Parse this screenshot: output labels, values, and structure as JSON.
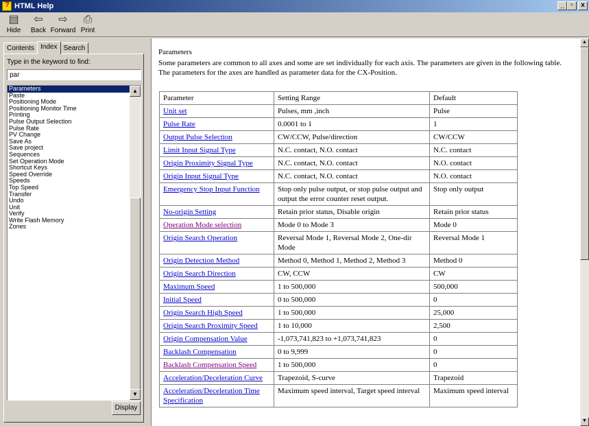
{
  "window": {
    "title": "HTML Help",
    "controls": [
      "_",
      "▫",
      "x"
    ]
  },
  "toolbar": [
    {
      "label": "Hide",
      "icon": "hide-pane-icon",
      "glyph": "▤"
    },
    {
      "label": "Back",
      "icon": "back-arrow-icon",
      "glyph": "⇦"
    },
    {
      "label": "Forward",
      "icon": "forward-arrow-icon",
      "glyph": "⇨"
    },
    {
      "label": "Print",
      "icon": "printer-icon",
      "glyph": "⎙"
    }
  ],
  "nav": {
    "tabs": [
      "Contents",
      "Index",
      "Search"
    ],
    "active_tab": "Index",
    "prompt": "Type in the keyword to find:",
    "keyword": "par",
    "items": [
      "Parameters",
      "Paste",
      "Positioning Mode",
      "Positioning Monitor Time",
      "Printing",
      "Pulse Output Selection",
      "Pulse Rate",
      "PV Change",
      "Save As",
      "Save project",
      "Sequences",
      "Set Operation Mode",
      "Shortcut Keys",
      "Speed Override",
      "Speeds",
      "Top Speed",
      "Transfer",
      "Undo",
      "Unit",
      "Verify",
      "Write Flash Memory",
      "Zones"
    ],
    "selected_item": "Parameters",
    "display_label": "Display"
  },
  "content": {
    "title": "Parameters",
    "intro": "Some parameters are common to all axes and some are set individually for each axis. The parameters are given in the following table. The parameters for the axes are handled as parameter data for the CX-Position.",
    "headers": [
      "Parameter",
      "Setting Range",
      "Default"
    ],
    "rows": [
      {
        "param": "Unit set",
        "range": "Pulses, mm ,inch",
        "default": "Pulse",
        "visited": false
      },
      {
        "param": "Pulse Rate",
        "range": "0.0001 to 1",
        "default": "1",
        "visited": false
      },
      {
        "param": "Output Pulse Selection",
        "range": "CW/CCW, Pulse/direction",
        "default": "CW/CCW",
        "visited": false
      },
      {
        "param": "Limit Input Signal Type",
        "range": "N.C. contact, N.O. contact",
        "default": "N.C. contact",
        "visited": false
      },
      {
        "param": "Origin Proximity Signal Type",
        "range": "N.C. contact, N.O. contact",
        "default": "N.O. contact",
        "visited": false
      },
      {
        "param": "Origin Input Signal Type",
        "range": "N.C. contact, N.O. contact",
        "default": "N.O. contact",
        "visited": false
      },
      {
        "param": "Emergency Stop Input Function",
        "range": "Stop only pulse output, or stop pulse output and output the error counter reset output.",
        "default": "Stop only output",
        "visited": false
      },
      {
        "param": "No-origin Setting",
        "range": "Retain prior status, Disable origin",
        "default": "Retain prior status",
        "visited": false
      },
      {
        "param": "Operation Mode selection",
        "range": "Mode 0 to Mode 3",
        "default": "Mode 0",
        "visited": true
      },
      {
        "param": "Origin Search Operation",
        "range": "Reversal Mode 1, Reversal Mode 2, One-dir Mode",
        "default": "Reversal Mode 1",
        "visited": false
      },
      {
        "param": "Origin Detection Method",
        "range": "Method 0, Method 1, Method 2, Method 3",
        "default": "Method 0",
        "visited": false
      },
      {
        "param": "Origin Search Direction",
        "range": "CW, CCW",
        "default": "CW",
        "visited": false
      },
      {
        "param": "Maximum Speed",
        "range": "1 to 500,000",
        "default": "500,000",
        "visited": false
      },
      {
        "param": "Initial Speed",
        "range": "0 to 500,000",
        "default": "0",
        "visited": false
      },
      {
        "param": "Origin Search High Speed",
        "range": "1 to 500,000",
        "default": "25,000",
        "visited": false
      },
      {
        "param": "Origin Search Proximity Speed",
        "range": "1 to 10,000",
        "default": "2,500",
        "visited": false
      },
      {
        "param": "Origin Compensation Value",
        "range": "-1,073,741,823 to +1,073,741,823",
        "default": "0",
        "visited": false
      },
      {
        "param": "Backlash Compensation",
        "range": "0 to 9,999",
        "default": "0",
        "visited": false
      },
      {
        "param": "Backlash Compensation Speed",
        "range": "1 to 500,000",
        "default": "0",
        "visited": true
      },
      {
        "param": "Acceleration/Deceleration Curve",
        "range": "Trapezoid, S-curve",
        "default": "Trapezoid",
        "visited": false
      },
      {
        "param": "Acceleration/Deceleration Time Specification",
        "range": "Maximum speed interval, Target speed interval",
        "default": "Maximum speed interval",
        "visited": false
      }
    ]
  }
}
